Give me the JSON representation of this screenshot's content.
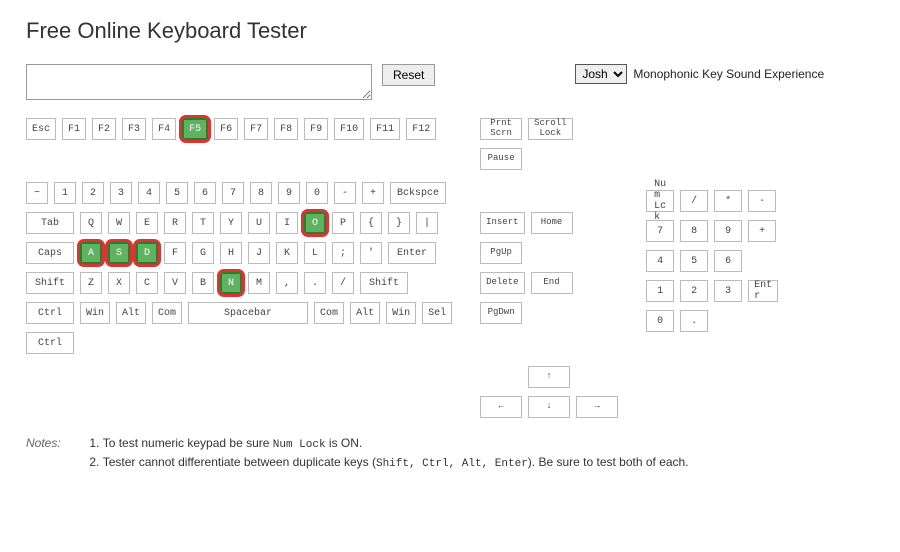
{
  "title": "Free Online Keyboard Tester",
  "reset": "Reset",
  "sound_select": "Josh",
  "sound_label": "Monophonic Key Sound Experience",
  "main_rows": [
    [
      {
        "l": "Esc"
      },
      {
        "l": "F1"
      },
      {
        "l": "F2"
      },
      {
        "l": "F3"
      },
      {
        "l": "F4"
      },
      {
        "l": "F5",
        "pressed": true,
        "ring": true
      },
      {
        "l": "F6"
      },
      {
        "l": "F7"
      },
      {
        "l": "F8"
      },
      {
        "l": "F9"
      },
      {
        "l": "F10"
      },
      {
        "l": "F11"
      },
      {
        "l": "F12"
      }
    ],
    [
      {
        "l": "~"
      },
      {
        "l": "1"
      },
      {
        "l": "2"
      },
      {
        "l": "3"
      },
      {
        "l": "4"
      },
      {
        "l": "5"
      },
      {
        "l": "6"
      },
      {
        "l": "7"
      },
      {
        "l": "8"
      },
      {
        "l": "9"
      },
      {
        "l": "0"
      },
      {
        "l": "-"
      },
      {
        "l": "+"
      },
      {
        "l": "Bckspce",
        "cls": "w25"
      }
    ],
    [
      {
        "l": "Tab",
        "cls": "w2"
      },
      {
        "l": "Q"
      },
      {
        "l": "W"
      },
      {
        "l": "E"
      },
      {
        "l": "R"
      },
      {
        "l": "T"
      },
      {
        "l": "Y"
      },
      {
        "l": "U"
      },
      {
        "l": "I"
      },
      {
        "l": "O",
        "pressed": true,
        "ring": true
      },
      {
        "l": "P"
      },
      {
        "l": "{"
      },
      {
        "l": "}"
      },
      {
        "l": "|"
      }
    ],
    [
      {
        "l": "Caps",
        "cls": "w2"
      },
      {
        "l": "A",
        "pressed": true,
        "ring": true
      },
      {
        "l": "S",
        "pressed": true,
        "ring": true
      },
      {
        "l": "D",
        "pressed": true,
        "ring": true
      },
      {
        "l": "F"
      },
      {
        "l": "G"
      },
      {
        "l": "H"
      },
      {
        "l": "J"
      },
      {
        "l": "K"
      },
      {
        "l": "L"
      },
      {
        "l": ";"
      },
      {
        "l": "'"
      },
      {
        "l": "Enter",
        "cls": "w2"
      }
    ],
    [
      {
        "l": "Shift",
        "cls": "w2"
      },
      {
        "l": "Z"
      },
      {
        "l": "X"
      },
      {
        "l": "C"
      },
      {
        "l": "V"
      },
      {
        "l": "B"
      },
      {
        "l": "N",
        "pressed": true,
        "ring": true
      },
      {
        "l": "M"
      },
      {
        "l": ","
      },
      {
        "l": "."
      },
      {
        "l": "/"
      },
      {
        "l": "Shift",
        "cls": "w2"
      }
    ],
    [
      {
        "l": "Ctrl",
        "cls": "w2"
      },
      {
        "l": "Win"
      },
      {
        "l": "Alt"
      },
      {
        "l": "Com"
      },
      {
        "l": "Spacebar",
        "cls": "wspace"
      },
      {
        "l": "Com"
      },
      {
        "l": "Alt"
      },
      {
        "l": "Win"
      },
      {
        "l": "Sel"
      }
    ],
    [
      {
        "l": "Ctrl",
        "cls": "w2"
      }
    ]
  ],
  "nav_rows": [
    [
      {
        "l": "Prnt\nScrn"
      },
      {
        "l": "Scroll\nLock"
      }
    ],
    [
      {
        "l": "Pause"
      }
    ],
    [
      {
        "l": "Insert"
      },
      {
        "l": "Home"
      }
    ],
    [
      {
        "l": "PgUp"
      }
    ],
    [
      {
        "l": "Delete"
      },
      {
        "l": "End"
      }
    ],
    [
      {
        "l": "PgDwn"
      }
    ]
  ],
  "arrows": {
    "up": "↑",
    "left": "←",
    "down": "↓",
    "right": "→"
  },
  "numpad_rows": [
    [
      {
        "l": "Nu\nm\nLc\nk"
      },
      {
        "l": "/"
      },
      {
        "l": "*"
      },
      {
        "l": "-"
      }
    ],
    [
      {
        "l": "7"
      },
      {
        "l": "8"
      },
      {
        "l": "9"
      },
      {
        "l": "+"
      }
    ],
    [
      {
        "l": "4"
      },
      {
        "l": "5"
      },
      {
        "l": "6"
      }
    ],
    [
      {
        "l": "1"
      },
      {
        "l": "2"
      },
      {
        "l": "3"
      },
      {
        "l": "Ent\nr"
      }
    ],
    [
      {
        "l": "0"
      },
      {
        "l": "."
      }
    ]
  ],
  "notes_heading": "Notes:",
  "notes": {
    "n1a": "To test numeric keypad be sure ",
    "n1code": "Num Lock",
    "n1b": " is ON.",
    "n2a": "Tester cannot differentiate between duplicate keys (",
    "n2code": "Shift, Ctrl, Alt, Enter",
    "n2b": "). Be sure to test both of each."
  }
}
